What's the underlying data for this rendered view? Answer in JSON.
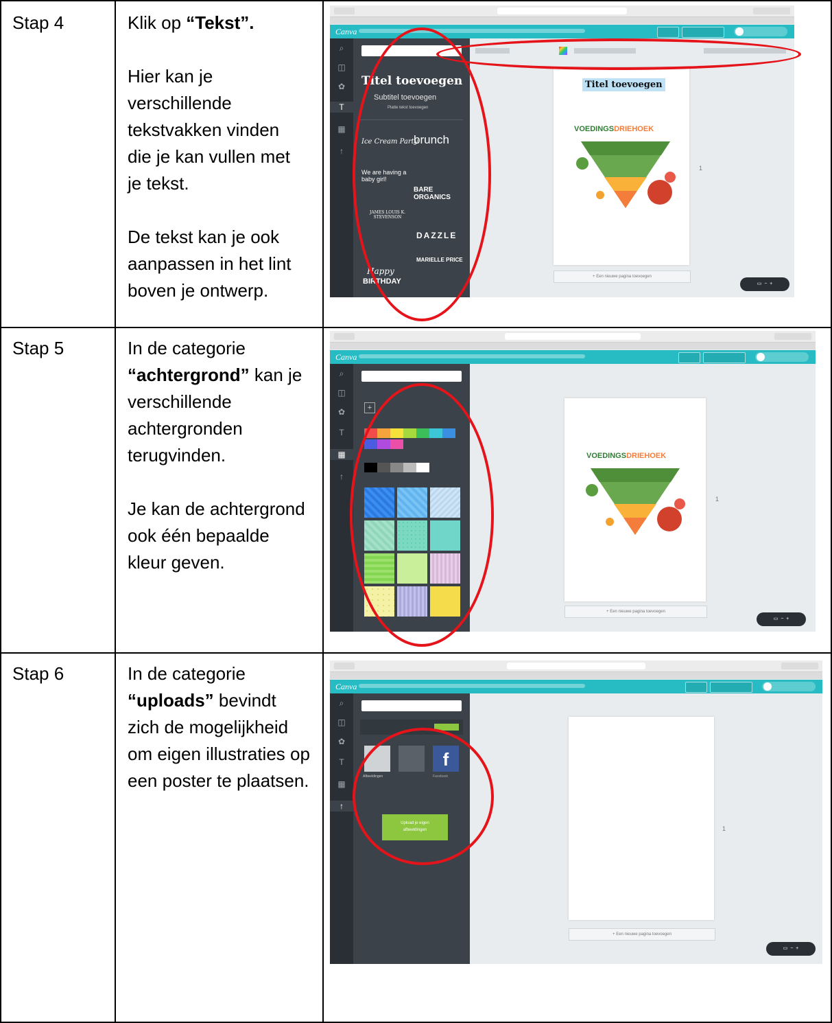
{
  "rows": [
    {
      "step": "Stap 4",
      "paragraphs": [
        {
          "before": "Klik op ",
          "bold": "“Tekst”.",
          "after": ""
        },
        {
          "before": "Hier kan je verschillende tekstvakken vinden die je kan vullen met je tekst.",
          "bold": "",
          "after": ""
        },
        {
          "before": "De tekst kan je ook aanpassen in het lint boven je ontwerp.",
          "bold": "",
          "after": ""
        }
      ]
    },
    {
      "step": "Stap 5",
      "paragraphs": [
        {
          "before": "In de categorie ",
          "bold": "“achtergrond”",
          "after": " kan je verschillende achtergronden terugvinden."
        },
        {
          "before": "Je kan de achtergrond ook één bepaalde kleur geven.",
          "bold": "",
          "after": ""
        }
      ]
    },
    {
      "step": "Stap 6",
      "paragraphs": [
        {
          "before": "In de categorie ",
          "bold": "“uploads”",
          "after": " bevindt zich de mogelijkheid om eigen illustraties op een poster te plaatsen."
        }
      ]
    }
  ],
  "screens": {
    "app_logo": "Canva",
    "design_title_4": "Titel toevoegen",
    "subtitle_4": "Subtitel toevoegen",
    "body_4": "Platte tekst toevoegen",
    "fonts_samples": [
      "Ice Cream Party",
      "brunch",
      "We are having a baby girl!",
      "BARE ORGANICS",
      "JAMES LOUIS K. STEVENSON",
      "DAZZLE",
      "MARIELLE PRICE",
      "Happy",
      "BIRTHDAY"
    ],
    "pyramid_title_a": "VOEDINGS",
    "pyramid_title_b": "DRIEHOEK",
    "add_page": "+ Een nieuwe pagina toevoegen",
    "upload_button": "Upload je eigen afbeeldingen",
    "upload_types": [
      "Afbeeldingen",
      "Facebook"
    ],
    "page_number": "1"
  },
  "colors": {
    "canva_teal": "#27bcc3",
    "rail": "#2a2f35",
    "panel": "#3b4249",
    "annotation_red": "#e5141a",
    "upload_green": "#8dc63f"
  }
}
